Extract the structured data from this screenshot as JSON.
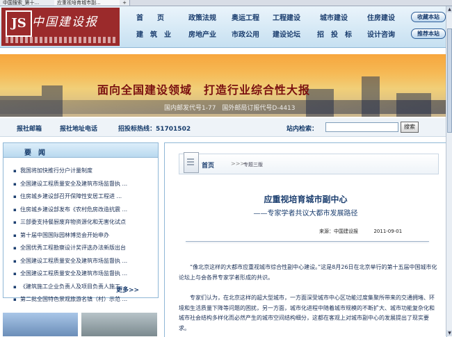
{
  "browser": {
    "tabs": [
      {
        "label": "中国搜索_第十..."
      },
      {
        "label": "应重视培育城市副..."
      },
      {
        "label": "+"
      }
    ]
  },
  "header": {
    "logo_mark": "JS",
    "logo_text": "中国建设报",
    "nav_row1": [
      "首　　页",
      "政策法规",
      "奥运工程",
      "工程建设",
      "城市建设",
      "住房建设"
    ],
    "nav_row2": [
      "建　筑　业",
      "房地产业",
      "市政公用",
      "建设论坛",
      "招　投　标",
      "设计咨询"
    ],
    "buttons": {
      "bookmark": "收藏本站",
      "recommend": "推荐本站"
    }
  },
  "banner": {
    "slogan": "面向全国建设领域　打造行业综合性大报",
    "postcode": "国内邮发代号1-77　国外邮局订报代号D-4413"
  },
  "infobar": {
    "subscribe": "报社邮箱",
    "address": "报社地址电话",
    "hotline": "招投标热线：51701502",
    "search_label": "站内检索：",
    "search_placeholder": "",
    "search_button": "搜索"
  },
  "news": {
    "title": "要闻",
    "items": [
      "我国将加快推行分户计量制度",
      "全国建设工程质量安全及建筑市场监督执 ...",
      "住房城乡建设部召开保障性安居工程进 ...",
      "住房城乡建设部发布《农村危房改造抗震 ...",
      "三部委支持餐厨废弃物资源化和无害化试点",
      "第十届中国国际园林博览会开始申办",
      "全国优秀工程勘察设计奖评选办法新版出台",
      "全国建设工程质量安全及建筑市场监督执 ...",
      "全国建设工程质量安全及建筑市场监督执 ...",
      "《建筑施工企业负责人及项目负责人施工 ...",
      "第二批全国特色景观旅游名镇（村）示范 ..."
    ],
    "more": "更多>>"
  },
  "article": {
    "breadcrumb_home": "首页",
    "breadcrumb_sep": ">>>",
    "breadcrumb_current": "专题三版",
    "title": "应重视培育城市副中心",
    "subtitle": "——专家学者共议大都市发展路径",
    "source": "来源：中国建设报",
    "date": "2011-09-01",
    "paragraphs": [
      "“像北京这样的大都市应重视城市综合性副中心建设。”这是8月26日在北京举行的第十五届中国城市化论坛上与会各界专家学者形成的共识。",
      "专家们认为，在北京这样的超大型城市，一方面深受城市中心区功能过度集聚所带来的交通拥堵、环境和生活质量下降等问题的困扰，另一方面，城市化进程中随着城市规模的不断扩大、城市功能复杂化和城市社会结构多样化而必然产生的城市空间结构细分，这都在客观上对城市副中心的发展提出了现实要求。"
    ]
  },
  "colors": {
    "brand_red": "#9b2a2b",
    "nav_blue": "#1a3d6e",
    "header_bg": "#c6e0f1"
  }
}
